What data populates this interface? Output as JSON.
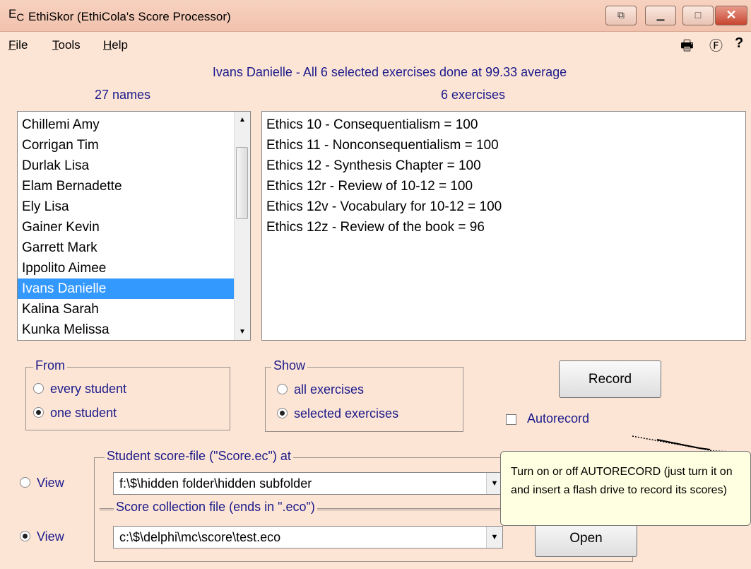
{
  "window": {
    "icon_text": "E",
    "icon_sub": "C",
    "title": "EthiSkor (EthiCola's Score Processor)",
    "btn_restore_glyph": "⧉",
    "btn_minimize_glyph": "▁",
    "btn_maximize_glyph": "□",
    "btn_close_glyph": "✕"
  },
  "menu": {
    "file": {
      "key": "F",
      "rest": "ile"
    },
    "tools": {
      "key": "T",
      "rest": "ools"
    },
    "help": {
      "key": "H",
      "rest": "elp"
    },
    "print_glyph": "🖶",
    "f_glyph": "Ⓕ",
    "help_glyph": "?"
  },
  "status_line": "Ivans Danielle  -  All 6 selected exercises done at 99.33 average",
  "names": {
    "count_label": "27 names",
    "items": [
      "Chillemi Amy",
      "Corrigan Tim",
      "Durlak Lisa",
      "Elam Bernadette",
      "Ely Lisa",
      "Gainer Kevin",
      "Garrett Mark",
      "Ippolito Aimee",
      "Ivans Danielle",
      "Kalina Sarah",
      "Kunka Melissa"
    ],
    "selected_index": 8
  },
  "exercises": {
    "count_label": "6 exercises",
    "items": [
      "Ethics 10 - Consequentialism = 100",
      "Ethics 11 - Nonconsequentialism = 100",
      "Ethics 12 - Synthesis Chapter = 100",
      "Ethics 12r - Review of 10-12 = 100",
      "Ethics 12v - Vocabulary for 10-12 = 100",
      "Ethics 12z - Review of the book = 96"
    ]
  },
  "from_group": {
    "legend": "From",
    "option1": "every student",
    "option2": "one student",
    "selected": 2
  },
  "show_group": {
    "legend": "Show",
    "option1": "all exercises",
    "option2": "selected exercises",
    "selected": 2
  },
  "record_button": "Record",
  "autorecord": {
    "label": "Autorecord",
    "checked": false
  },
  "score_file": {
    "legend": "Student score-file (\"Score.ec\") at",
    "path": "f:\\$\\hidden folder\\hidden subfolder",
    "view_label": "View",
    "selected": false
  },
  "collection_file": {
    "legend": "Score collection file (ends in \".eco\")",
    "path": "c:\\$\\delphi\\mc\\score\\test.eco",
    "view_label": "View",
    "selected": true
  },
  "open_button": "Open",
  "tooltip": "Turn on or off AUTORECORD (just turn it on and insert a flash drive to record its scores)",
  "colors": {
    "background": "#fde5d6",
    "label_text": "#1a1a8a",
    "selection": "#3399ff"
  }
}
